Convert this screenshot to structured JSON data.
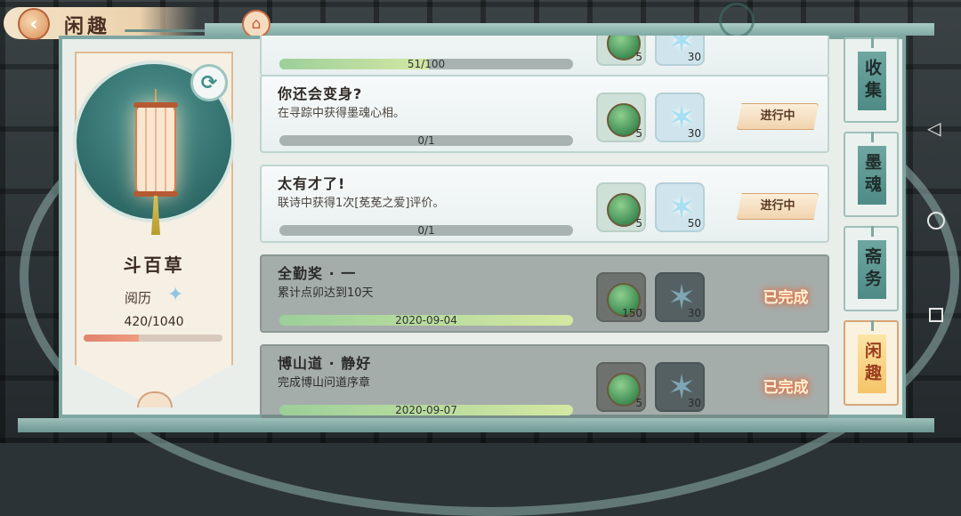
{
  "header": {
    "title": "闲趣",
    "back_icon": "chevron-left-icon",
    "home_icon": "home-icon"
  },
  "profile": {
    "name": "斗百草",
    "exp_label": "阅历",
    "exp_value": "420/1040",
    "exp_progress": 0.4,
    "refresh_icon": "refresh-icon",
    "lantern_icon": "lantern-icon"
  },
  "tasks": [
    {
      "title": "",
      "desc": "",
      "rewards": [
        {
          "type": "coin",
          "count": "5"
        },
        {
          "type": "star",
          "count": "30"
        }
      ],
      "progress_text": "51/100",
      "progress": 0.51,
      "status": "",
      "done": false
    },
    {
      "title": "你还会变身?",
      "desc": "在寻踪中获得墨魂心相。",
      "rewards": [
        {
          "type": "coin",
          "count": "5"
        },
        {
          "type": "star",
          "count": "30"
        }
      ],
      "progress_text": "0/1",
      "progress": 0,
      "status": "进行中",
      "done": false
    },
    {
      "title": "太有才了!",
      "desc": "联诗中获得1次[莬莬之爱]评价。",
      "rewards": [
        {
          "type": "coin",
          "count": "5"
        },
        {
          "type": "star",
          "count": "50"
        }
      ],
      "progress_text": "0/1",
      "progress": 0,
      "status": "进行中",
      "done": false
    },
    {
      "title": "全勤奖 · 一",
      "desc": "累计点卯达到10天",
      "rewards": [
        {
          "type": "coin",
          "count": "150"
        },
        {
          "type": "star",
          "count": "30"
        }
      ],
      "progress_text": "2020-09-04",
      "progress": 1,
      "status": "已完成",
      "done": true
    },
    {
      "title": "博山道 · 静好",
      "desc": "完成博山问道序章",
      "rewards": [
        {
          "type": "coin",
          "count": "5"
        },
        {
          "type": "star",
          "count": "30"
        }
      ],
      "progress_text": "2020-09-07",
      "progress": 1,
      "status": "已完成",
      "done": true
    }
  ],
  "tabs": [
    {
      "label": "收集",
      "active": false
    },
    {
      "label": "墨魂",
      "active": false
    },
    {
      "label": "斋务",
      "active": false
    },
    {
      "label": "闲趣",
      "active": true
    }
  ],
  "colors": {
    "accent_teal": "#4f8b86",
    "status_orange": "#e86a3a",
    "progress_green": "#9ccf9a"
  }
}
